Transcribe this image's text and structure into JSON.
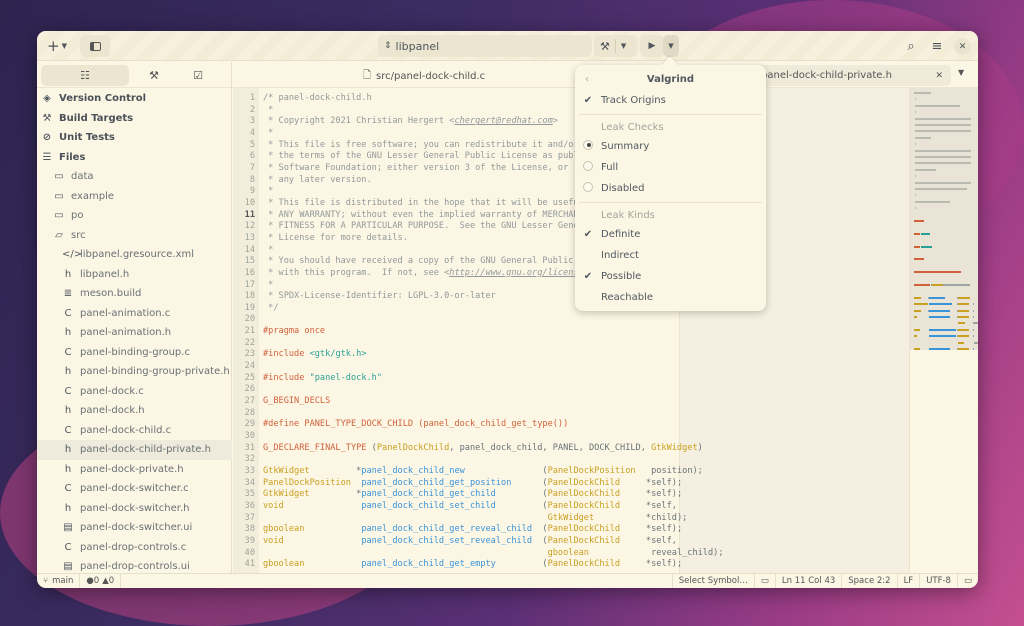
{
  "header": {
    "add_icon": "plus-icon",
    "project": "libpanel",
    "close_icon": "close-icon"
  },
  "sidebar": {
    "tabs": [
      "list-icon",
      "build-icon",
      "check-icon"
    ],
    "sections": [
      {
        "label": "Version Control",
        "icon": "◈"
      },
      {
        "label": "Build Targets",
        "icon": "⚒"
      },
      {
        "label": "Unit Tests",
        "icon": "⊘"
      },
      {
        "label": "Files",
        "icon": "☰"
      }
    ],
    "folders": [
      {
        "label": "data",
        "icon": "▭"
      },
      {
        "label": "example",
        "icon": "▭"
      },
      {
        "label": "po",
        "icon": "▭"
      },
      {
        "label": "src",
        "icon": "▱"
      }
    ],
    "files": [
      {
        "label": "libpanel.gresource.xml",
        "icon": "</>"
      },
      {
        "label": "libpanel.h",
        "icon": "h"
      },
      {
        "label": "meson.build",
        "icon": "≣"
      },
      {
        "label": "panel-animation.c",
        "icon": "C"
      },
      {
        "label": "panel-animation.h",
        "icon": "h"
      },
      {
        "label": "panel-binding-group.c",
        "icon": "C"
      },
      {
        "label": "panel-binding-group-private.h",
        "icon": "h"
      },
      {
        "label": "panel-dock.c",
        "icon": "C"
      },
      {
        "label": "panel-dock.h",
        "icon": "h"
      },
      {
        "label": "panel-dock-child.c",
        "icon": "C"
      },
      {
        "label": "panel-dock-child-private.h",
        "icon": "h",
        "selected": true
      },
      {
        "label": "panel-dock-private.h",
        "icon": "h"
      },
      {
        "label": "panel-dock-switcher.c",
        "icon": "C"
      },
      {
        "label": "panel-dock-switcher.h",
        "icon": "h"
      },
      {
        "label": "panel-dock-switcher.ui",
        "icon": "▤"
      },
      {
        "label": "panel-drop-controls.c",
        "icon": "C"
      },
      {
        "label": "panel-drop-controls.ui",
        "icon": "▤"
      }
    ]
  },
  "tabs": {
    "left": "src/panel-dock-child.c",
    "right": "panel-dock-child-private.h"
  },
  "editor": {
    "current_line": 11,
    "lines": [
      [
        [
          "c",
          "/* panel-dock-child.h"
        ]
      ],
      [
        [
          "c",
          " *"
        ]
      ],
      [
        [
          "c",
          " * Copyright 2021 Christian Hergert <"
        ],
        [
          "u",
          "chergert@redhat.com"
        ],
        [
          "c",
          ">"
        ]
      ],
      [
        [
          "c",
          " *"
        ]
      ],
      [
        [
          "c",
          " * This file is free software; you can redistribute it and/or modify it under"
        ]
      ],
      [
        [
          "c",
          " * the terms of the GNU Lesser General Public License as published by the Free"
        ]
      ],
      [
        [
          "c",
          " * Software Foundation; either version 3 of the License, or (at your option)"
        ]
      ],
      [
        [
          "c",
          " * any later version."
        ]
      ],
      [
        [
          "c",
          " *"
        ]
      ],
      [
        [
          "c",
          " * This file is distributed in the hope that it will be useful, but WITHOUT"
        ]
      ],
      [
        [
          "c",
          " * ANY WARRANTY; without even the implied warranty of MERCHANTABILITY or"
        ]
      ],
      [
        [
          "c",
          " * FITNESS FOR A PARTICULAR PURPOSE.  See the GNU Lesser General Public"
        ]
      ],
      [
        [
          "c",
          " * License for more details."
        ]
      ],
      [
        [
          "c",
          " *"
        ]
      ],
      [
        [
          "c",
          " * You should have received a copy of the GNU General Public License along"
        ]
      ],
      [
        [
          "c",
          " * with this program.  If not, see <"
        ],
        [
          "u",
          "http://www.gnu.org/licenses/"
        ],
        [
          "c",
          ">."
        ]
      ],
      [
        [
          "c",
          " *"
        ]
      ],
      [
        [
          "c",
          " * SPDX-License-Identifier: LGPL-3.0-or-later"
        ]
      ],
      [
        [
          "c",
          " */"
        ]
      ],
      [],
      [
        [
          "p",
          "#pragma once"
        ]
      ],
      [],
      [
        [
          "p",
          "#include"
        ],
        [
          "s",
          " <gtk/gtk.h>"
        ]
      ],
      [],
      [
        [
          "p",
          "#include"
        ],
        [
          "s",
          " \"panel-dock.h\""
        ]
      ],
      [],
      [
        [
          "p",
          "G_BEGIN_DECLS"
        ]
      ],
      [],
      [
        [
          "p",
          "#define PANEL_TYPE_DOCK_CHILD (panel_dock_child_get_type())"
        ]
      ],
      [],
      [
        [
          "p",
          "G_DECLARE_FINAL_TYPE"
        ],
        [
          "n",
          " ("
        ],
        [
          "t",
          "PanelDockChild"
        ],
        [
          "n",
          ", panel_dock_child, PANEL, DOCK_CHILD, "
        ],
        [
          "t",
          "GtkWidget"
        ],
        [
          "n",
          ")"
        ]
      ],
      [],
      [
        [
          "t",
          "GtkWidget"
        ],
        [
          "n",
          "         *"
        ],
        [
          "f",
          "panel_dock_child_new"
        ],
        [
          "n",
          "               ("
        ],
        [
          "t",
          "PanelDockPosition"
        ],
        [
          "n",
          "   position);"
        ]
      ],
      [
        [
          "t",
          "PanelDockPosition"
        ],
        [
          "n",
          "  "
        ],
        [
          "f",
          "panel_dock_child_get_position"
        ],
        [
          "n",
          "      ("
        ],
        [
          "t",
          "PanelDockChild"
        ],
        [
          "n",
          "     *self);"
        ]
      ],
      [
        [
          "t",
          "GtkWidget"
        ],
        [
          "n",
          "         *"
        ],
        [
          "f",
          "panel_dock_child_get_child"
        ],
        [
          "n",
          "         ("
        ],
        [
          "t",
          "PanelDockChild"
        ],
        [
          "n",
          "     *self);"
        ]
      ],
      [
        [
          "t",
          "void"
        ],
        [
          "n",
          "               "
        ],
        [
          "f",
          "panel_dock_child_set_child"
        ],
        [
          "n",
          "         ("
        ],
        [
          "t",
          "PanelDockChild"
        ],
        [
          "n",
          "     *self,"
        ]
      ],
      [
        [
          "n",
          "                                                       "
        ],
        [
          "t",
          "GtkWidget"
        ],
        [
          "n",
          "          *child);"
        ]
      ],
      [
        [
          "t",
          "gboolean"
        ],
        [
          "n",
          "           "
        ],
        [
          "f",
          "panel_dock_child_get_reveal_child"
        ],
        [
          "n",
          "  ("
        ],
        [
          "t",
          "PanelDockChild"
        ],
        [
          "n",
          "     *self);"
        ]
      ],
      [
        [
          "t",
          "void"
        ],
        [
          "n",
          "               "
        ],
        [
          "f",
          "panel_dock_child_set_reveal_child"
        ],
        [
          "n",
          "  ("
        ],
        [
          "t",
          "PanelDockChild"
        ],
        [
          "n",
          "     *self,"
        ]
      ],
      [
        [
          "n",
          "                                                       "
        ],
        [
          "t",
          "gboolean"
        ],
        [
          "n",
          "            reveal_child);"
        ]
      ],
      [
        [
          "t",
          "gboolean"
        ],
        [
          "n",
          "           "
        ],
        [
          "f",
          "panel_dock_child_get_empty"
        ],
        [
          "n",
          "         ("
        ],
        [
          "t",
          "PanelDockChild"
        ],
        [
          "n",
          "     *self);"
        ]
      ]
    ]
  },
  "popover": {
    "title": "Valgrind",
    "track_origins": "Track Origins",
    "leak_checks": "Leak Checks",
    "summary": "Summary",
    "full": "Full",
    "disabled": "Disabled",
    "leak_kinds": "Leak Kinds",
    "definite": "Definite",
    "indirect": "Indirect",
    "possible": "Possible",
    "reachable": "Reachable",
    "selected_leak_check": "Summary",
    "checked": [
      "Track Origins",
      "Definite",
      "Possible"
    ]
  },
  "status": {
    "branch": "main",
    "errors": "0",
    "warnings": "0",
    "select_symbol": "Select Symbol…",
    "position": "Ln 11 Col 43",
    "indent": "Space 2:2",
    "line_ending": "LF",
    "encoding": "UTF-8"
  },
  "colors": {
    "background": "#fcf6e5",
    "comment": "#93999a",
    "preprocessor": "#d0623a",
    "string": "#2aa198",
    "type": "#c9a020",
    "function": "#3a94d8"
  }
}
